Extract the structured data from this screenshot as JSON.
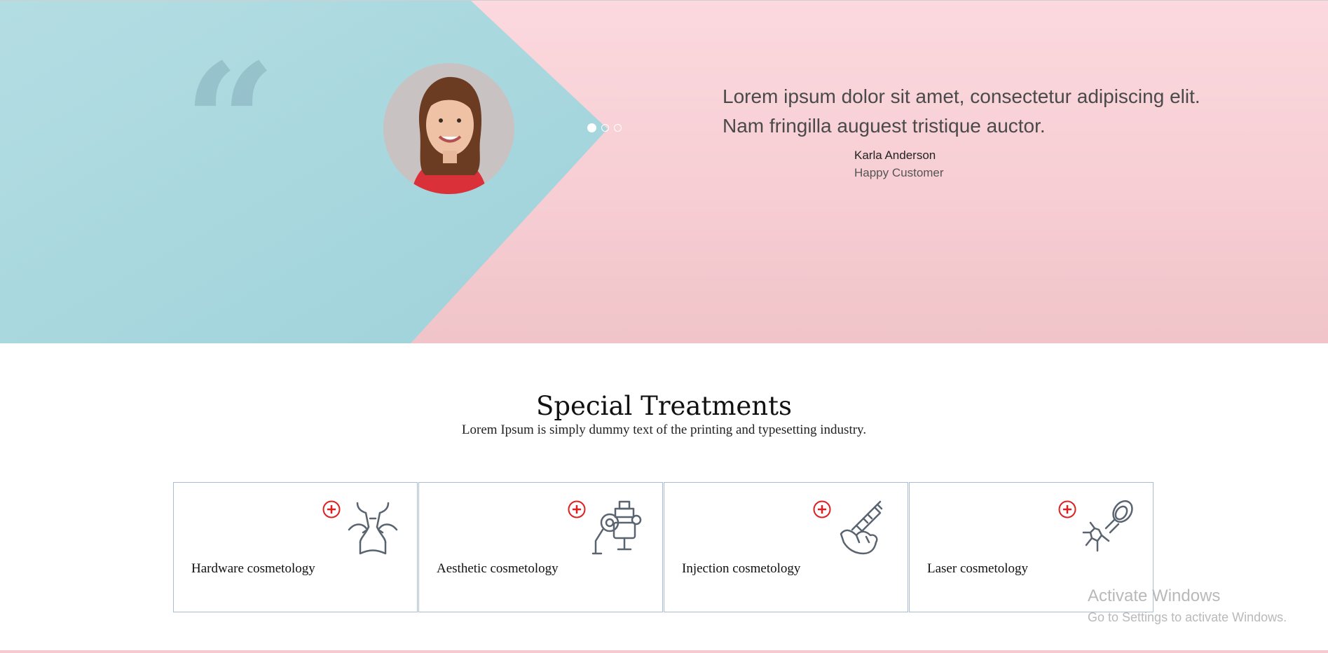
{
  "testimonial": {
    "quote": "Lorem ipsum dolor sit amet, consectetur adipiscing elit. Nam fringilla auguest tristique auctor.",
    "author": "Karla Anderson",
    "role": "Happy Customer",
    "slides_total": 3,
    "active_slide": 1,
    "colors": {
      "blue": "#a9d8df",
      "pink": "#f9d3d8"
    }
  },
  "treatments": {
    "title": "Special Treatments",
    "subtitle": "Lorem Ipsum is simply dummy text of the printing and typesetting industry.",
    "items": [
      {
        "label": "Hardware cosmetology",
        "icon": "body-shaping-icon"
      },
      {
        "label": "Aesthetic cosmetology",
        "icon": "aesthetic-device-icon"
      },
      {
        "label": "Injection cosmetology",
        "icon": "syringe-hand-icon"
      },
      {
        "label": "Laser cosmetology",
        "icon": "laser-device-icon"
      }
    ],
    "accent": "#e02020"
  },
  "watermark": {
    "title": "Activate Windows",
    "subtitle": "Go to Settings to activate Windows."
  }
}
